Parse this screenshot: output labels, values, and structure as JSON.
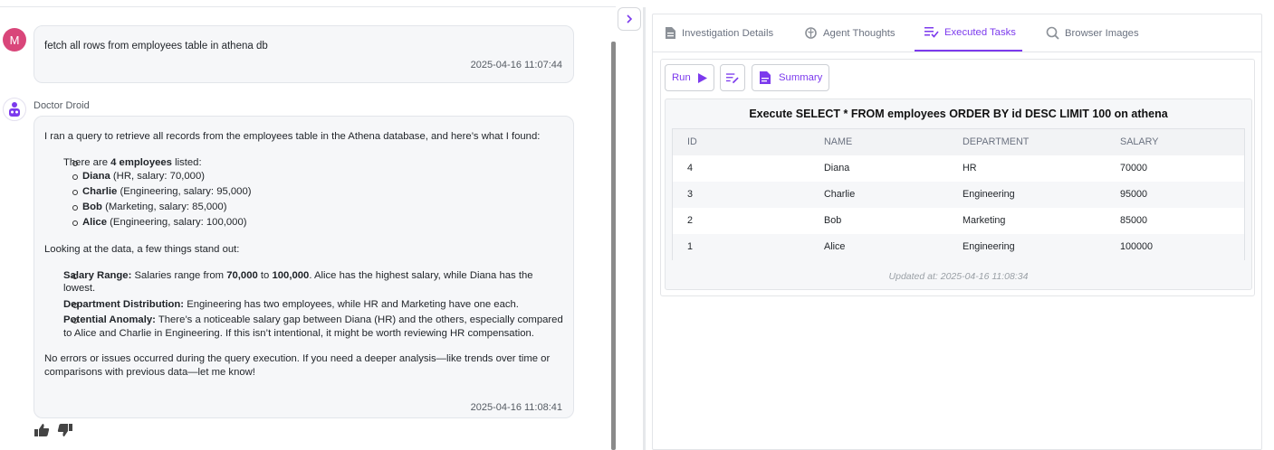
{
  "chat": {
    "user_avatar": "M",
    "user_message": "fetch all rows from employees table in athena db",
    "user_timestamp": "2025-04-16 11:07:44",
    "bot_name": "Doctor Droid",
    "bot_intro": "I ran a query to retrieve all records from the employees table in the Athena database, and here’s what I found:",
    "employees_prefix": "There are ",
    "employees_count": "4 employees",
    "employees_suffix": " listed:",
    "employees": [
      {
        "name": "Diana",
        "detail": " (HR, salary: 70,000)"
      },
      {
        "name": "Charlie",
        "detail": " (Engineering, salary: 95,000)"
      },
      {
        "name": "Bob",
        "detail": " (Marketing, salary: 85,000)"
      },
      {
        "name": "Alice",
        "detail": " (Engineering, salary: 100,000)"
      }
    ],
    "looking": "Looking at the data, a few things stand out:",
    "salary_range_label": "Salary Range:",
    "salary_range_a": " Salaries range from ",
    "salary_min": "70,000",
    "salary_to": " to ",
    "salary_max": "100,000",
    "salary_range_b": ". Alice has the highest salary, while Diana has the lowest.",
    "dept_label": "Department Distribution:",
    "dept_text": " Engineering has two employees, while HR and Marketing have one each.",
    "anomaly_label": "Potential Anomaly:",
    "anomaly_text": " There’s a noticeable salary gap between Diana (HR) and the others, especially compared to Alice and Charlie in Engineering. If this isn’t intentional, it might be worth reviewing HR compensation.",
    "closing": "No errors or issues occurred during the query execution. If you need a deeper analysis—like trends over time or comparisons with previous data—let me know!",
    "bot_timestamp": "2025-04-16 11:08:41"
  },
  "tabs": [
    {
      "label": "Investigation Details"
    },
    {
      "label": "Agent Thoughts"
    },
    {
      "label": "Executed Tasks"
    },
    {
      "label": "Browser Images"
    }
  ],
  "toolbar": {
    "run_label": "Run",
    "summary_label": "Summary"
  },
  "result": {
    "title": "Execute SELECT * FROM employees ORDER BY id DESC LIMIT 100 on athena",
    "columns": [
      "ID",
      "NAME",
      "DEPARTMENT",
      "SALARY"
    ],
    "rows": [
      [
        "4",
        "Diana",
        "HR",
        "70000"
      ],
      [
        "3",
        "Charlie",
        "Engineering",
        "95000"
      ],
      [
        "2",
        "Bob",
        "Marketing",
        "85000"
      ],
      [
        "1",
        "Alice",
        "Engineering",
        "100000"
      ]
    ],
    "updated": "Updated at: 2025-04-16 11:08:34"
  },
  "colors": {
    "accent": "#7c3aed",
    "user_avatar": "#d9467a"
  }
}
